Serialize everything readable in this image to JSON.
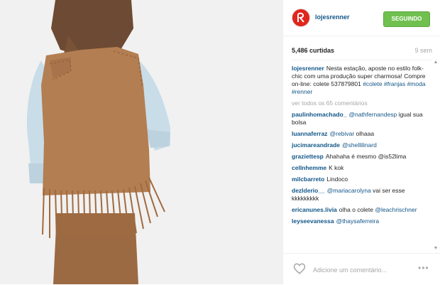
{
  "account": {
    "username": "lojesrenner",
    "follow_label": "SEGUINDO",
    "brand_color": "#e1261c",
    "follow_color": "#70c050"
  },
  "post": {
    "likes": "5,486 curtidas",
    "time": "9 sem"
  },
  "caption": {
    "username": "lojesrenner",
    "text": "Nesta estação, aposte no estilo folk-chic com uma produção super charmosa! Compre on-line: colete 537879801 ",
    "tags": "#colete #franjas #moda #renner"
  },
  "view_all": "ver todos os 65 comentários",
  "comments": [
    {
      "user": "paulinhomachado_",
      "mention": "@nathfernandesp",
      "text": " igual sua bolsa"
    },
    {
      "user": "luannaferraz",
      "mention": "@rebivar",
      "text": " olhaaa"
    },
    {
      "user": "jucimareandrade",
      "mention": "@shellilinard",
      "text": ""
    },
    {
      "user": "graziettesp",
      "mention": "",
      "text": "Ahahaha é mesmo @is52lima"
    },
    {
      "user": "cellnhemme",
      "mention": "",
      "text": "K kok"
    },
    {
      "user": "milcbarreto",
      "mention": "",
      "text": "Lindoco"
    },
    {
      "user": "dezlderio__",
      "mention": "@mariacarolyna",
      "text": " vai ser esse kkkkkkkkk"
    },
    {
      "user": "ericanunes.livia",
      "mention": "",
      "text": "olha o colete ",
      "mention2": "@leachrischner"
    },
    {
      "user": "leyseevanessa",
      "mention": "@thaysaferreira",
      "text": ""
    }
  ],
  "footer": {
    "placeholder": "Adicione um comentário...",
    "options": "•••"
  },
  "icons": {
    "like": "heart-icon",
    "options": "more-options-icon",
    "scroll_up": "scroll-up-arrow-icon",
    "scroll_down": "scroll-down-arrow-icon"
  }
}
